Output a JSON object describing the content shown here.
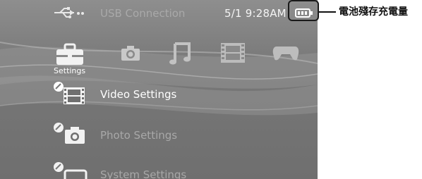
{
  "status_bar": {
    "usb_label": "USB Connection",
    "datetime": "5/1 9:28AM",
    "battery_icon": "battery-icon"
  },
  "annotation": {
    "text": "電池殘存充電量"
  },
  "categories": [
    {
      "name": "settings",
      "label": "Settings",
      "icon": "toolbox-icon",
      "selected": true
    },
    {
      "name": "photo",
      "label": "",
      "icon": "camera-icon",
      "selected": false
    },
    {
      "name": "music",
      "label": "",
      "icon": "music-note-icon",
      "selected": false
    },
    {
      "name": "video",
      "label": "",
      "icon": "film-icon",
      "selected": false
    },
    {
      "name": "game",
      "label": "",
      "icon": "gamepad-icon",
      "selected": false
    }
  ],
  "menu": {
    "items": [
      {
        "label": "Video Settings",
        "icon": "video-settings-icon",
        "highlighted": true
      },
      {
        "label": "Photo Settings",
        "icon": "photo-settings-icon",
        "highlighted": false
      },
      {
        "label": "System Settings",
        "icon": "system-settings-icon",
        "highlighted": false
      }
    ]
  },
  "colors": {
    "highlight_text": "#ffffff",
    "dim_text": "#a8a8a8",
    "annotation": "#111111"
  }
}
